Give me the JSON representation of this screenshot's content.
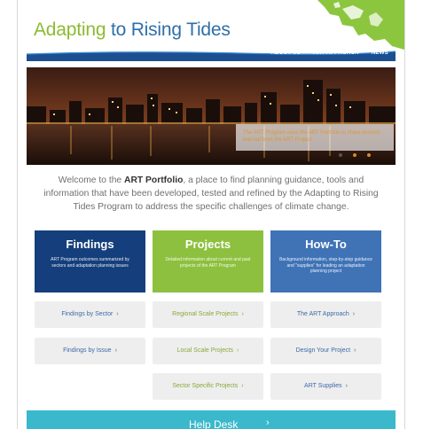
{
  "header": {
    "title_part1": "Adapting",
    "title_part2": " to Rising Tides",
    "nav": [
      "ABOUT US",
      "ART APPROACH",
      "NEWS"
    ]
  },
  "hero": {
    "caption": "The ART Program uses the ART Portfolio to share lessons learned from the ART Project.",
    "slides": 3,
    "active_slide": 1
  },
  "intro": {
    "before": "Welcome to the ",
    "bold": "ART Portfolio",
    "after": ", a place to find planning guidance, tools and information that have been developed, tested and refined by the Adapting to Rising Tides Program to address the specific challenges of climate change."
  },
  "cards": {
    "findings": {
      "title": "Findings",
      "desc": "ART Program outcomes summarized by sectors and adaptation planning issues"
    },
    "projects": {
      "title": "Projects",
      "desc": "Detailed information about current and past projects of the ART Program"
    },
    "howto": {
      "title": "How-To",
      "desc": "Background information, step-by-step guidance and \"supplies\" for leading an adaptation planning project"
    }
  },
  "links": {
    "findings_by_sector": "Findings by Sector",
    "findings_by_issue": "Findings by Issue",
    "regional_scale_projects": "Regional Scale Projects",
    "local_scale_projects": "Local Scale Projects",
    "sector_specific_projects": "Sector Specific Projects",
    "art_approach": "The ART Approach",
    "design_your_project": "Design Your Project",
    "art_supplies": "ART Supplies"
  },
  "help_desk": {
    "label": "Help Desk",
    "arrow": "›"
  },
  "colors": {
    "green": "#8cbb32",
    "blue": "#2e6fa8",
    "navy": "#153f7c",
    "mid_blue": "#3f73b6",
    "teal": "#3ab8cc"
  }
}
